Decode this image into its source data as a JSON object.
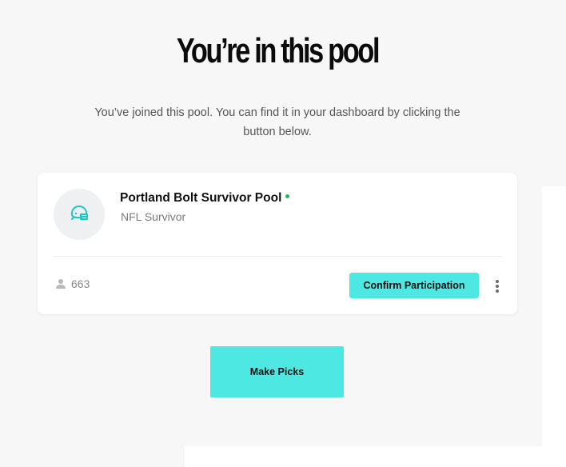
{
  "heading": "You’re in this pool",
  "message": "You’ve joined this pool. You can find it in your dashboard by clicking the button below.",
  "pool_card": {
    "name": "Portland Bolt Survivor Pool",
    "type": "NFL Survivor",
    "member_count": "663",
    "avatar_icon": "football-helmet-icon",
    "status_color": "#12c25a",
    "confirm_label": "Confirm Participation",
    "more_icon": "more-vertical-icon"
  },
  "make_picks_label": "Make Picks",
  "colors": {
    "accent": "#4de8e1",
    "helmet": "#20c7c9",
    "background": "#f7f7f7"
  }
}
